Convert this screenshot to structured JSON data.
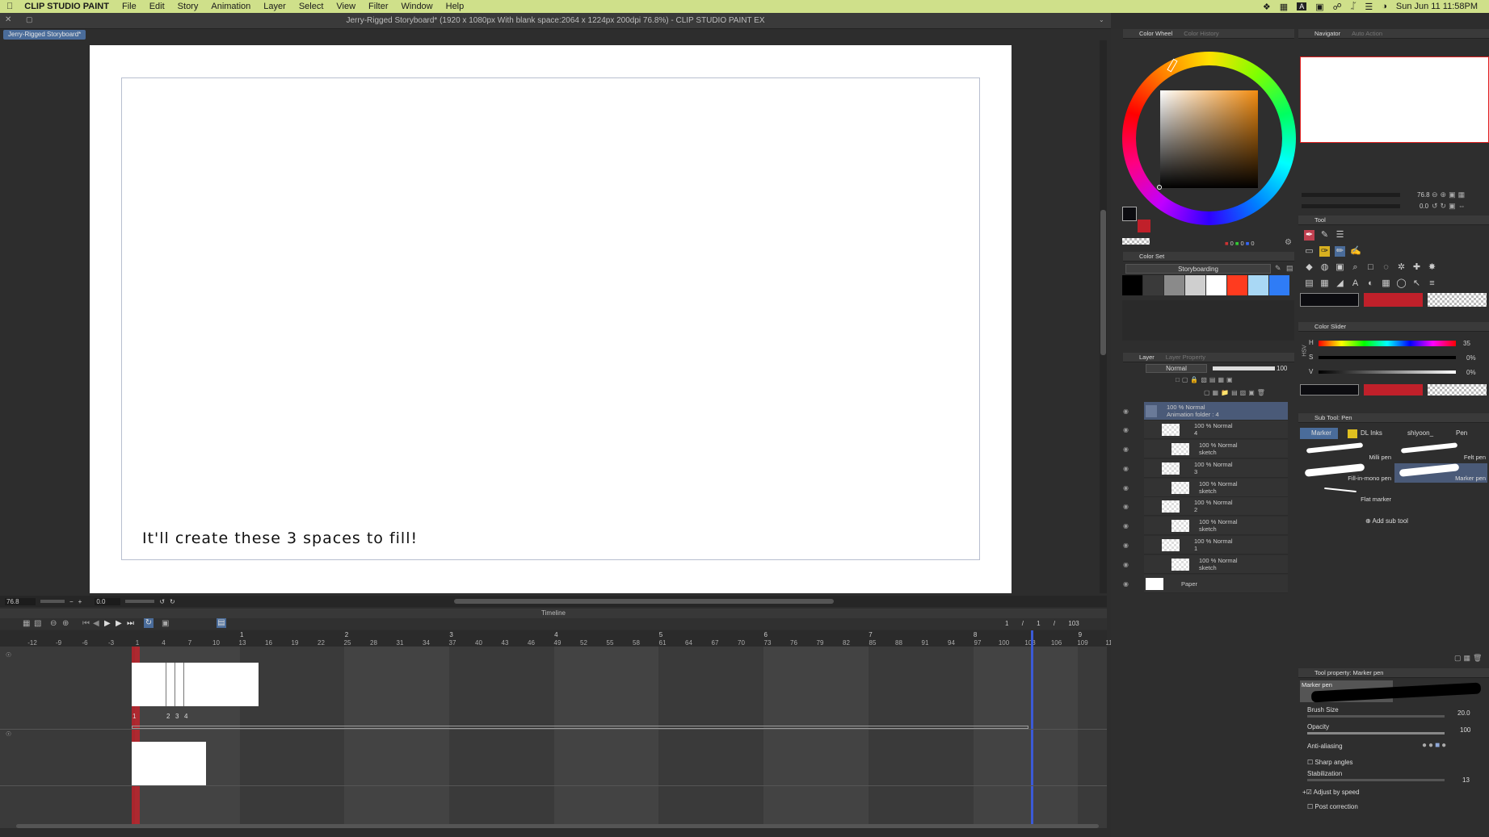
{
  "menubar": {
    "app": "CLIP STUDIO PAINT",
    "items": [
      "File",
      "Edit",
      "Story",
      "Animation",
      "Layer",
      "Select",
      "View",
      "Filter",
      "Window",
      "Help"
    ],
    "clock": "Sun Jun 11  11:58PM",
    "input_indicator": "A"
  },
  "window": {
    "title": "Jerry-Rigged Storyboard* (1920 x 1080px With blank space:2064 x 1224px 200dpi 76.8%)  - CLIP STUDIO PAINT EX",
    "doc_tab": "Jerry-Rigged Storyboard*"
  },
  "canvas": {
    "caption": "It'll create these 3 spaces to fill!"
  },
  "status": {
    "zoom": "76.8",
    "angle": "0.0"
  },
  "timeline": {
    "label": "Timeline",
    "frame_current": "1",
    "frame_sep": "/",
    "frame_start": "1",
    "frame_end": "103",
    "ruler_ticks": [
      "-12",
      "-9",
      "-6",
      "-3",
      "1",
      "4",
      "7",
      "10",
      "13",
      "16",
      "19",
      "22",
      "25",
      "28",
      "31",
      "34",
      "37",
      "40",
      "43",
      "46",
      "49",
      "52",
      "55",
      "58",
      "61",
      "64",
      "67",
      "70",
      "73",
      "76",
      "79",
      "82",
      "85",
      "88",
      "91",
      "94",
      "97",
      "100",
      "103",
      "106",
      "109",
      "11"
    ],
    "seconds": [
      "1",
      "2",
      "3",
      "4",
      "5",
      "6",
      "7",
      "8",
      "9"
    ],
    "cell_labels": [
      "1",
      "2",
      "3",
      "4"
    ]
  },
  "color_wheel": {
    "tab": "Color Wheel",
    "tab2": "Color History",
    "rgb": [
      "0",
      "0",
      "0"
    ]
  },
  "color_set": {
    "tab": "Color Set",
    "set_name": "Storyboarding",
    "swatches": [
      "#000000",
      "#3a3a3a",
      "#8a8a8a",
      "#cfcfcf",
      "#ffffff",
      "#ff3b1f",
      "#a9d8f5",
      "#2f7cf6"
    ]
  },
  "layer": {
    "tab": "Layer",
    "tab2": "Layer Property",
    "blend": "Normal",
    "opacity": "100",
    "rows": [
      {
        "l1": "100 % Normal",
        "l2": "Animation folder : 4"
      },
      {
        "l1": "100 % Normal",
        "l2": "4"
      },
      {
        "l1": "100 % Normal",
        "l2": "sketch"
      },
      {
        "l1": "100 % Normal",
        "l2": "3"
      },
      {
        "l1": "100 % Normal",
        "l2": "sketch"
      },
      {
        "l1": "100 % Normal",
        "l2": "2"
      },
      {
        "l1": "100 % Normal",
        "l2": "sketch"
      },
      {
        "l1": "100 % Normal",
        "l2": "1"
      },
      {
        "l1": "100 % Normal",
        "l2": "sketch"
      },
      {
        "l1": "Paper",
        "l2": ""
      }
    ]
  },
  "navigator": {
    "tab": "Navigator",
    "tab2": "Auto Action",
    "zoom": "76.8",
    "angle": "0.0"
  },
  "tool": {
    "tab": "Tool"
  },
  "color_slider": {
    "tab": "Color Slider",
    "h_label": "H",
    "s_label": "S",
    "v_label": "V",
    "h": "35",
    "s": "0%",
    "v": "0%",
    "mode": "HSV"
  },
  "sub_tool": {
    "tab": "Sub Tool: Pen",
    "groups": [
      "Marker",
      "DL Inks",
      "shiyoon_",
      "Pen"
    ],
    "brushes": [
      "Milli pen",
      "Felt pen",
      "Fill-in-mono pen",
      "Marker pen",
      "Flat marker"
    ],
    "add": "Add sub tool"
  },
  "tool_property": {
    "tab": "Tool property: Marker pen",
    "preview_label": "Marker pen",
    "brush_size_label": "Brush Size",
    "brush_size": "20.0",
    "opacity_label": "Opacity",
    "opacity": "100",
    "antialias_label": "Anti-aliasing",
    "sharp_label": "Sharp angles",
    "stab_label": "Stabilization",
    "stab": "13",
    "adjust_label": "Adjust by speed",
    "post_label": "Post correction"
  },
  "colors": {
    "menubar_bg": "#cfe08a",
    "main_color": "#0c0c10",
    "sub_color": "#c0202a",
    "accent_blue": "#4a6c9a",
    "playhead": "#d0202a"
  }
}
